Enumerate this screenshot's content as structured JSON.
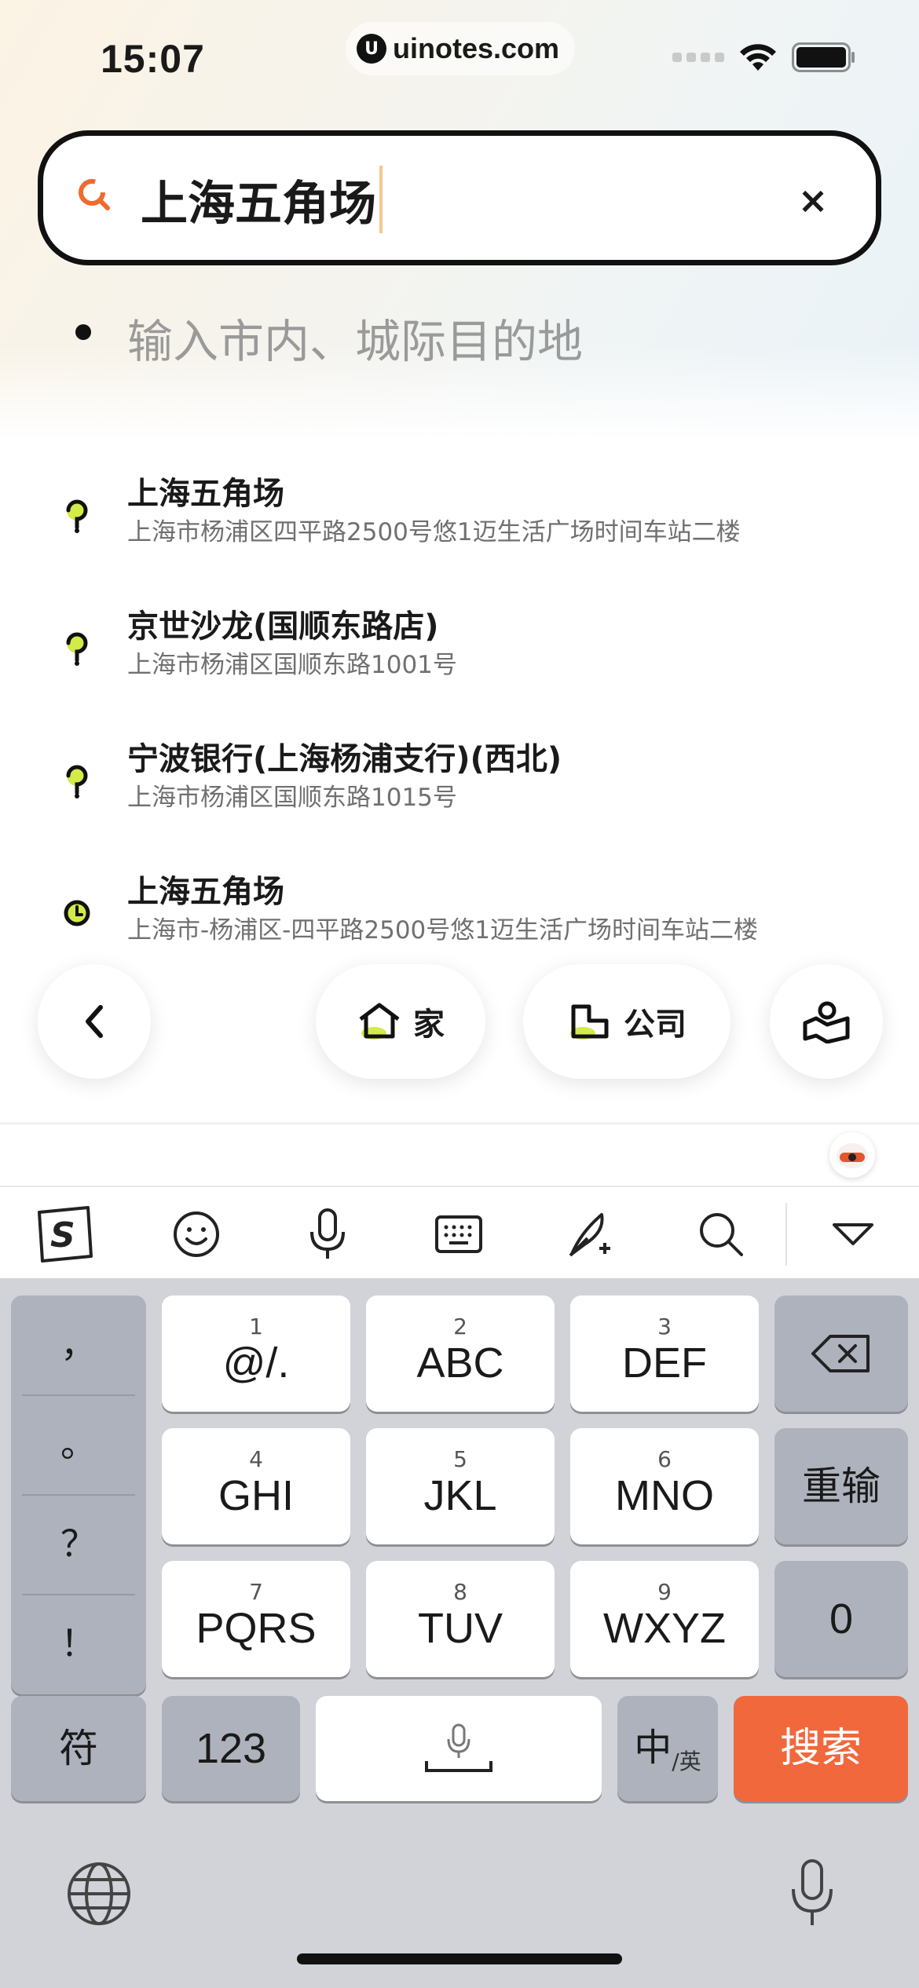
{
  "status_bar": {
    "time": "15:07",
    "url": "uinotes.com"
  },
  "search": {
    "query": "上海五角场",
    "clear_label": "×"
  },
  "destination": {
    "placeholder": "输入市内、城际目的地"
  },
  "suggestions": [
    {
      "title": "上海五角场",
      "address": "上海市杨浦区四平路2500号悠1迈生活广场时间车站二楼"
    },
    {
      "title": "京世沙龙(国顺东路店)",
      "address": "上海市杨浦区国顺东路1001号"
    },
    {
      "title": "宁波银行(上海杨浦支行)(西北)",
      "address": "上海市杨浦区国顺东路1015号"
    },
    {
      "title": "上海五角场",
      "address": "上海市-杨浦区-四平路2500号悠1迈生活广场时间车站二楼"
    }
  ],
  "quick_buttons": {
    "home": "家",
    "company": "公司"
  },
  "keyboard": {
    "punctuation": [
      "，",
      "。",
      "？",
      "！"
    ],
    "keys": [
      {
        "num": "1",
        "label": "@/."
      },
      {
        "num": "2",
        "label": "ABC"
      },
      {
        "num": "3",
        "label": "DEF"
      },
      {
        "num": "4",
        "label": "GHI"
      },
      {
        "num": "5",
        "label": "JKL"
      },
      {
        "num": "6",
        "label": "MNO"
      },
      {
        "num": "7",
        "label": "PQRS"
      },
      {
        "num": "8",
        "label": "TUV"
      },
      {
        "num": "9",
        "label": "WXYZ"
      }
    ],
    "retype": "重输",
    "zero": "0",
    "symbols": "符",
    "numbers": "123",
    "lang_main": "中",
    "lang_sub": "/英",
    "search": "搜索"
  },
  "colors": {
    "accent": "#f0683c",
    "pin_green": "#d4ea4a"
  }
}
